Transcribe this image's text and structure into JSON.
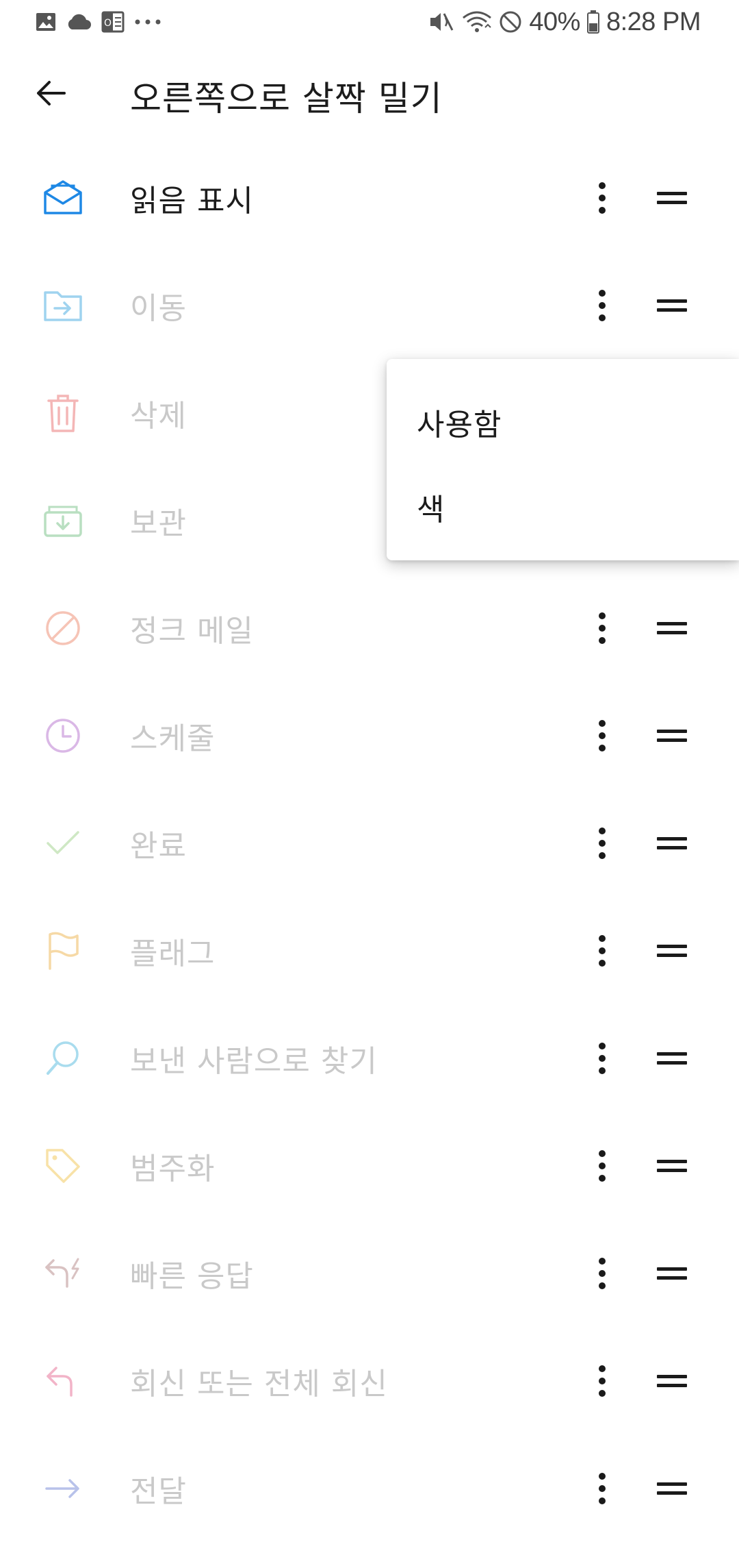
{
  "status_bar": {
    "battery": "40%",
    "time": "8:28 PM",
    "left_icons": [
      "image-icon",
      "cloud-icon",
      "office-icon",
      "more-notifications-icon"
    ],
    "right_icons": [
      "mute-icon",
      "wifi-icon",
      "do-not-disturb-icon",
      "battery-icon"
    ]
  },
  "header": {
    "title": "오른쪽으로 살짝 밀기",
    "back_icon": "arrow-left-icon"
  },
  "actions": [
    {
      "label": "읽음 표시",
      "icon": "mail-open-icon",
      "color": "#1e88e5",
      "enabled": true
    },
    {
      "label": "이동",
      "icon": "folder-move-icon",
      "color": "#9fd3ef",
      "enabled": false
    },
    {
      "label": "삭제",
      "icon": "trash-icon",
      "color": "#f4b6b6",
      "enabled": false
    },
    {
      "label": "보관",
      "icon": "archive-icon",
      "color": "#b9dfc1",
      "enabled": false
    },
    {
      "label": "정크 메일",
      "icon": "block-icon",
      "color": "#f6c4b6",
      "enabled": false
    },
    {
      "label": "스케줄",
      "icon": "clock-icon",
      "color": "#dab8e6",
      "enabled": false
    },
    {
      "label": "완료",
      "icon": "check-icon",
      "color": "#cfe8c4",
      "enabled": false
    },
    {
      "label": "플래그",
      "icon": "flag-icon",
      "color": "#f6d9a6",
      "enabled": false
    },
    {
      "label": "보낸 사람으로 찾기",
      "icon": "search-icon",
      "color": "#a9dcee",
      "enabled": false
    },
    {
      "label": "범주화",
      "icon": "tag-icon",
      "color": "#f8e2a8",
      "enabled": false
    },
    {
      "label": "빠른 응답",
      "icon": "quick-reply-icon",
      "color": "#d9c2c2",
      "enabled": false
    },
    {
      "label": "회신 또는 전체 회신",
      "icon": "reply-icon",
      "color": "#f2b4c8",
      "enabled": false
    },
    {
      "label": "전달",
      "icon": "forward-icon",
      "color": "#b8c2ea",
      "enabled": false
    }
  ],
  "popup_menu": {
    "items": [
      "사용함",
      "색"
    ]
  }
}
